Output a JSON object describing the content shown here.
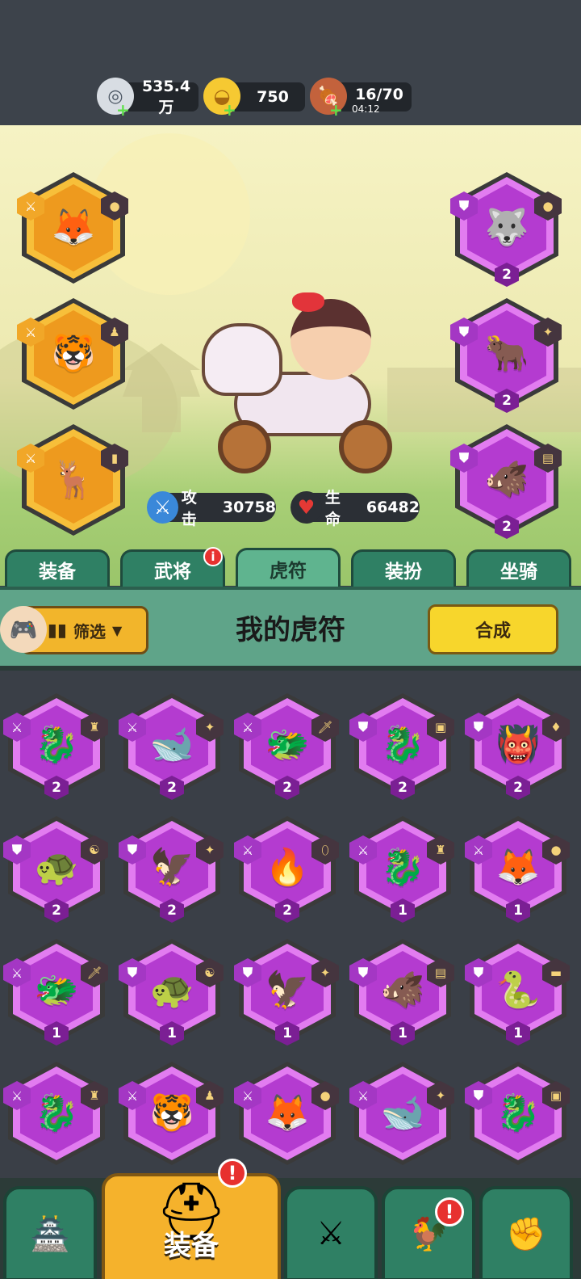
{
  "resources": {
    "silver": {
      "value": "535.4万",
      "icon": "silver-coin-icon"
    },
    "gold": {
      "value": "750",
      "icon": "gold-ingot-icon"
    },
    "stamina": {
      "value": "16/70",
      "timer": "04:12",
      "icon": "meat-icon"
    }
  },
  "hero_stats": {
    "attack_label": "攻击",
    "attack_value": "30758",
    "hp_label": "生命",
    "hp_value": "66482"
  },
  "equipped_left": [
    {
      "beast": "fox",
      "rarity": "gold",
      "glyph": "🦊",
      "badge": "⚔",
      "gem": "●"
    },
    {
      "beast": "tiger",
      "rarity": "gold",
      "glyph": "🐯",
      "badge": "⚔",
      "gem": "♟"
    },
    {
      "beast": "deer",
      "rarity": "gold",
      "glyph": "🦌",
      "badge": "⚔",
      "gem": "▮"
    }
  ],
  "equipped_right": [
    {
      "beast": "wolf",
      "rarity": "purple",
      "glyph": "🐺",
      "badge": "⛊",
      "gem": "●",
      "level": "2"
    },
    {
      "beast": "ox",
      "rarity": "purple",
      "glyph": "🐂",
      "badge": "⛊",
      "gem": "✦",
      "level": "2"
    },
    {
      "beast": "boar",
      "rarity": "purple",
      "glyph": "🐗",
      "badge": "⛊",
      "gem": "▤",
      "level": "2"
    }
  ],
  "tabs": [
    {
      "label": "装备",
      "active": false
    },
    {
      "label": "武将",
      "active": false,
      "dot": "i"
    },
    {
      "label": "虎符",
      "active": true
    },
    {
      "label": "装扮",
      "active": false
    },
    {
      "label": "坐骑",
      "active": false
    }
  ],
  "panel": {
    "filter_label": "筛选",
    "title": "我的虎符",
    "craft_label": "合成"
  },
  "inventory": [
    {
      "glyph": "🐉",
      "badge": "⚔",
      "gem": "♜",
      "level": "2"
    },
    {
      "glyph": "🐋",
      "badge": "⚔",
      "gem": "✦",
      "level": "2"
    },
    {
      "glyph": "🐲",
      "badge": "⚔",
      "gem": "🗡",
      "level": "2"
    },
    {
      "glyph": "🐉",
      "badge": "⛊",
      "gem": "▣",
      "level": "2"
    },
    {
      "glyph": "👹",
      "badge": "⛊",
      "gem": "♦",
      "level": "2"
    },
    {
      "glyph": "🐢",
      "badge": "⛊",
      "gem": "☯",
      "level": "2"
    },
    {
      "glyph": "🦅",
      "badge": "⛊",
      "gem": "✦",
      "level": "2"
    },
    {
      "glyph": "🔥",
      "badge": "⚔",
      "gem": "⬯",
      "level": "2"
    },
    {
      "glyph": "🐉",
      "badge": "⚔",
      "gem": "♜",
      "level": "1"
    },
    {
      "glyph": "🦊",
      "badge": "⚔",
      "gem": "●",
      "level": "1"
    },
    {
      "glyph": "🐲",
      "badge": "⚔",
      "gem": "🗡",
      "level": "1"
    },
    {
      "glyph": "🐢",
      "badge": "⛊",
      "gem": "☯",
      "level": "1"
    },
    {
      "glyph": "🦅",
      "badge": "⛊",
      "gem": "✦",
      "level": "1"
    },
    {
      "glyph": "🐗",
      "badge": "⛊",
      "gem": "▤",
      "level": "1"
    },
    {
      "glyph": "🐍",
      "badge": "⛊",
      "gem": "▬",
      "level": "1"
    },
    {
      "glyph": "🐉",
      "badge": "⚔",
      "gem": "♜",
      "level": ""
    },
    {
      "glyph": "🐯",
      "badge": "⚔",
      "gem": "♟",
      "level": ""
    },
    {
      "glyph": "🦊",
      "badge": "⚔",
      "gem": "●",
      "level": ""
    },
    {
      "glyph": "🐋",
      "badge": "⚔",
      "gem": "✦",
      "level": ""
    },
    {
      "glyph": "🐉",
      "badge": "⛊",
      "gem": "▣",
      "level": ""
    }
  ],
  "bottom_nav": [
    {
      "name": "nav-city",
      "glyph": "🏯"
    },
    {
      "name": "nav-equipment",
      "glyph": "⛑",
      "label": "装备",
      "active": true,
      "alert": "!"
    },
    {
      "name": "nav-battle",
      "glyph": "⚔"
    },
    {
      "name": "nav-heroes",
      "glyph": "🐓",
      "alert": "!"
    },
    {
      "name": "nav-upgrade",
      "glyph": "✊"
    }
  ],
  "colors": {
    "gold_tile": "#ee9a1e",
    "purple_tile": "#b43bd0",
    "tab_green": "#2f8064",
    "accent_yellow": "#f7d62c"
  }
}
